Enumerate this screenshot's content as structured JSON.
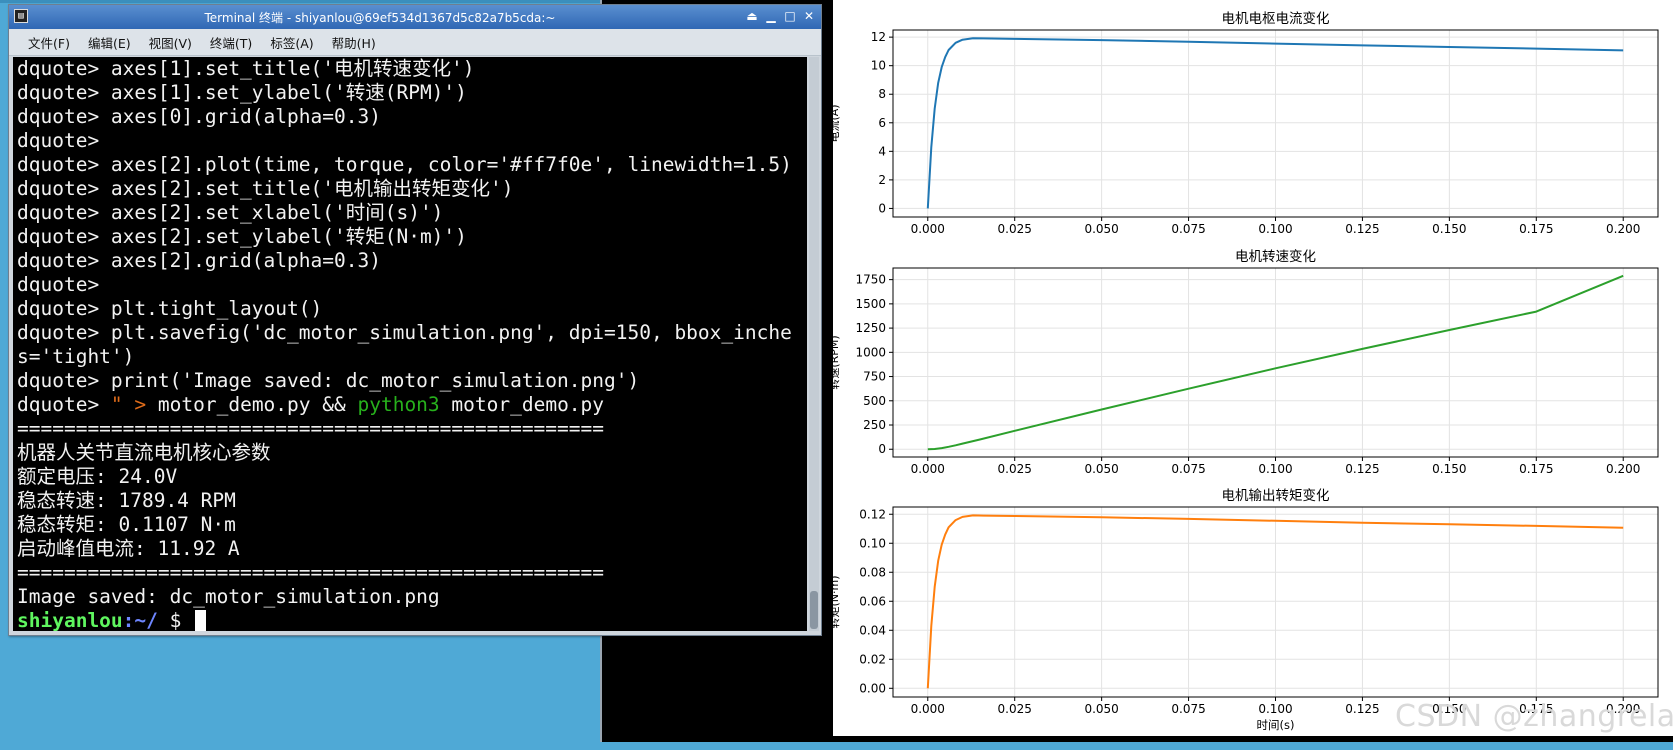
{
  "terminal": {
    "title": "Terminal 终端 - shiyanlou@69ef534d1367d5c82a7b5cda:~",
    "app_icon": "terminal-icon",
    "window_buttons": [
      "⏏",
      "▁",
      "□",
      "✕"
    ],
    "menu": [
      "文件(F)",
      "编辑(E)",
      "视图(V)",
      "终端(T)",
      "标签(A)",
      "帮助(H)"
    ],
    "lines": [
      "dquote> axes[1].set_title('电机转速变化')",
      "dquote> axes[1].set_ylabel('转速(RPM)')",
      "dquote> axes[0].grid(alpha=0.3)",
      "dquote>",
      "dquote> axes[2].plot(time, torque, color='#ff7f0e', linewidth=1.5)",
      "dquote> axes[2].set_title('电机输出转矩变化')",
      "dquote> axes[2].set_xlabel('时间(s)')",
      "dquote> axes[2].set_ylabel('转矩(N·m)')",
      "dquote> axes[2].grid(alpha=0.3)",
      "dquote>",
      "dquote> plt.tight_layout()",
      "dquote> plt.savefig('dc_motor_simulation.png', dpi=150, bbox_inche",
      "s='tight')",
      "dquote> print('Image saved: dc_motor_simulation.png')"
    ],
    "command": {
      "prefix": "dquote> ",
      "quote": "\" >",
      "mid": " motor_demo.py && ",
      "python": "python3",
      "tail": " motor_demo.py"
    },
    "output": [
      "==================================================",
      "机器人关节直流电机核心参数",
      "额定电压: 24.0V",
      "稳态转速: 1789.4 RPM",
      "稳态转矩: 0.1107 N·m",
      "启动峰值电流: 11.92 A",
      "==================================================",
      "Image saved: dc_motor_simulation.png"
    ],
    "prompt": {
      "user": "shiyanlou",
      "path": ":~/",
      "symbol": " $ "
    }
  },
  "viewer": {
    "watermark": "CSDN @zhangrelay"
  },
  "chart_data": [
    {
      "type": "line",
      "title": "电机电枢电流变化",
      "xlabel": "",
      "ylabel": "电流(A)",
      "xlim": [
        -0.01,
        0.21
      ],
      "ylim": [
        -0.6,
        12.5
      ],
      "xticks": [
        "0.000",
        "0.025",
        "0.050",
        "0.075",
        "0.100",
        "0.125",
        "0.150",
        "0.175",
        "0.200"
      ],
      "yticks": [
        "0",
        "2",
        "4",
        "6",
        "8",
        "10",
        "12"
      ],
      "grid": true,
      "color": "#1f77b4",
      "x": [
        0,
        0.001,
        0.002,
        0.003,
        0.004,
        0.005,
        0.006,
        0.008,
        0.01,
        0.013,
        0.016,
        0.025,
        0.05,
        0.075,
        0.1,
        0.125,
        0.15,
        0.175,
        0.2
      ],
      "y": [
        0,
        4.3,
        7.0,
        8.8,
        9.9,
        10.6,
        11.1,
        11.6,
        11.82,
        11.92,
        11.91,
        11.88,
        11.79,
        11.68,
        11.55,
        11.42,
        11.31,
        11.2,
        11.07
      ]
    },
    {
      "type": "line",
      "title": "电机转速变化",
      "xlabel": "",
      "ylabel": "转速(RPM)",
      "xlim": [
        -0.01,
        0.21
      ],
      "ylim": [
        -80,
        1870
      ],
      "xticks": [
        "0.000",
        "0.025",
        "0.050",
        "0.075",
        "0.100",
        "0.125",
        "0.150",
        "0.175",
        "0.200"
      ],
      "yticks": [
        "0",
        "250",
        "500",
        "750",
        "1000",
        "1250",
        "1500",
        "1750"
      ],
      "grid": true,
      "color": "#2ca02c",
      "x": [
        0,
        0.002,
        0.004,
        0.006,
        0.008,
        0.01,
        0.015,
        0.025,
        0.05,
        0.075,
        0.1,
        0.125,
        0.15,
        0.175,
        0.2
      ],
      "y": [
        0,
        3,
        12,
        25,
        41,
        58,
        101,
        190,
        410,
        625,
        835,
        1035,
        1230,
        1420,
        1789.4
      ]
    },
    {
      "type": "line",
      "title": "电机输出转矩变化",
      "xlabel": "时间(s)",
      "ylabel": "转矩(N·m)",
      "xlim": [
        -0.01,
        0.21
      ],
      "ylim": [
        -0.006,
        0.125
      ],
      "xticks": [
        "0.000",
        "0.025",
        "0.050",
        "0.075",
        "0.100",
        "0.125",
        "0.150",
        "0.175",
        "0.200"
      ],
      "yticks": [
        "0.00",
        "0.02",
        "0.04",
        "0.06",
        "0.08",
        "0.10",
        "0.12"
      ],
      "grid": true,
      "color": "#ff7f0e",
      "x": [
        0,
        0.001,
        0.002,
        0.003,
        0.004,
        0.005,
        0.006,
        0.008,
        0.01,
        0.013,
        0.016,
        0.025,
        0.05,
        0.075,
        0.1,
        0.125,
        0.15,
        0.175,
        0.2
      ],
      "y": [
        0,
        0.043,
        0.07,
        0.088,
        0.099,
        0.106,
        0.111,
        0.116,
        0.1182,
        0.1192,
        0.1191,
        0.1188,
        0.1179,
        0.1168,
        0.1155,
        0.1142,
        0.1131,
        0.112,
        0.1107
      ]
    }
  ]
}
